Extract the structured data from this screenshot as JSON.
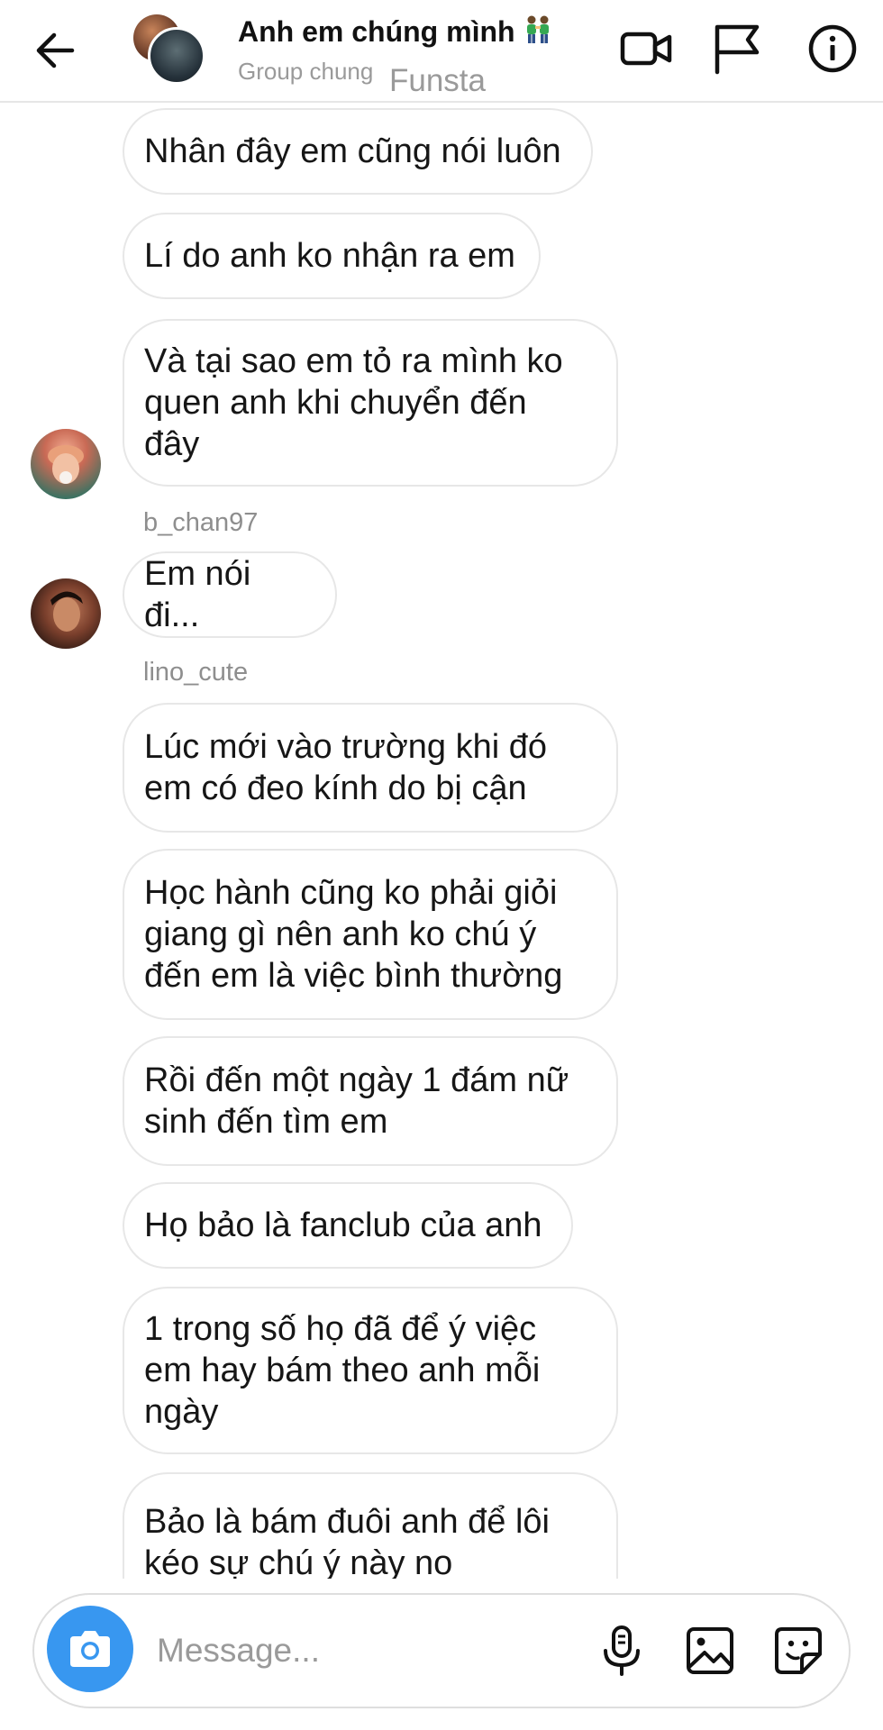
{
  "header": {
    "title": "Anh em chúng mình",
    "title_emoji": "👬",
    "subtitle": "Group chung",
    "watermark": "Funsta",
    "icons": [
      "back-arrow-icon",
      "video-camera-icon",
      "flag-icon",
      "info-icon"
    ]
  },
  "messages": [
    {
      "text": "Nhân đây em cũng nói luôn"
    },
    {
      "text": "Lí do anh ko nhận ra em"
    },
    {
      "text": "Và tại sao em tỏ ra mình ko\nquen anh khi chuyển đến\nđây"
    },
    {
      "username": "b_chan97"
    },
    {
      "text": "Em nói đi..."
    },
    {
      "username": "lino_cute"
    },
    {
      "text": "Lúc mới vào trường khi đó\nem có đeo kính do bị cận"
    },
    {
      "text": "Học hành cũng ko phải giỏi\ngiang gì nên anh ko chú ý\nđến em là việc bình thường"
    },
    {
      "text": "Rồi đến một ngày 1 đám nữ\nsinh đến tìm em"
    },
    {
      "text": "Họ bảo là fanclub của anh"
    },
    {
      "text": "1 trong số họ đã để ý việc\nem hay bám theo anh mỗi\nngày"
    },
    {
      "text": "Bảo là bám đuôi anh để lôi\nkéo sự chú ý này no"
    }
  ],
  "composer": {
    "placeholder": "Message...",
    "value": "",
    "icons": [
      "camera-icon",
      "microphone-icon",
      "gallery-icon",
      "sticker-icon"
    ]
  },
  "colors": {
    "accent": "#3897f0",
    "bubble_border": "#e7e7e7",
    "secondary_text": "#8e8e8e"
  }
}
